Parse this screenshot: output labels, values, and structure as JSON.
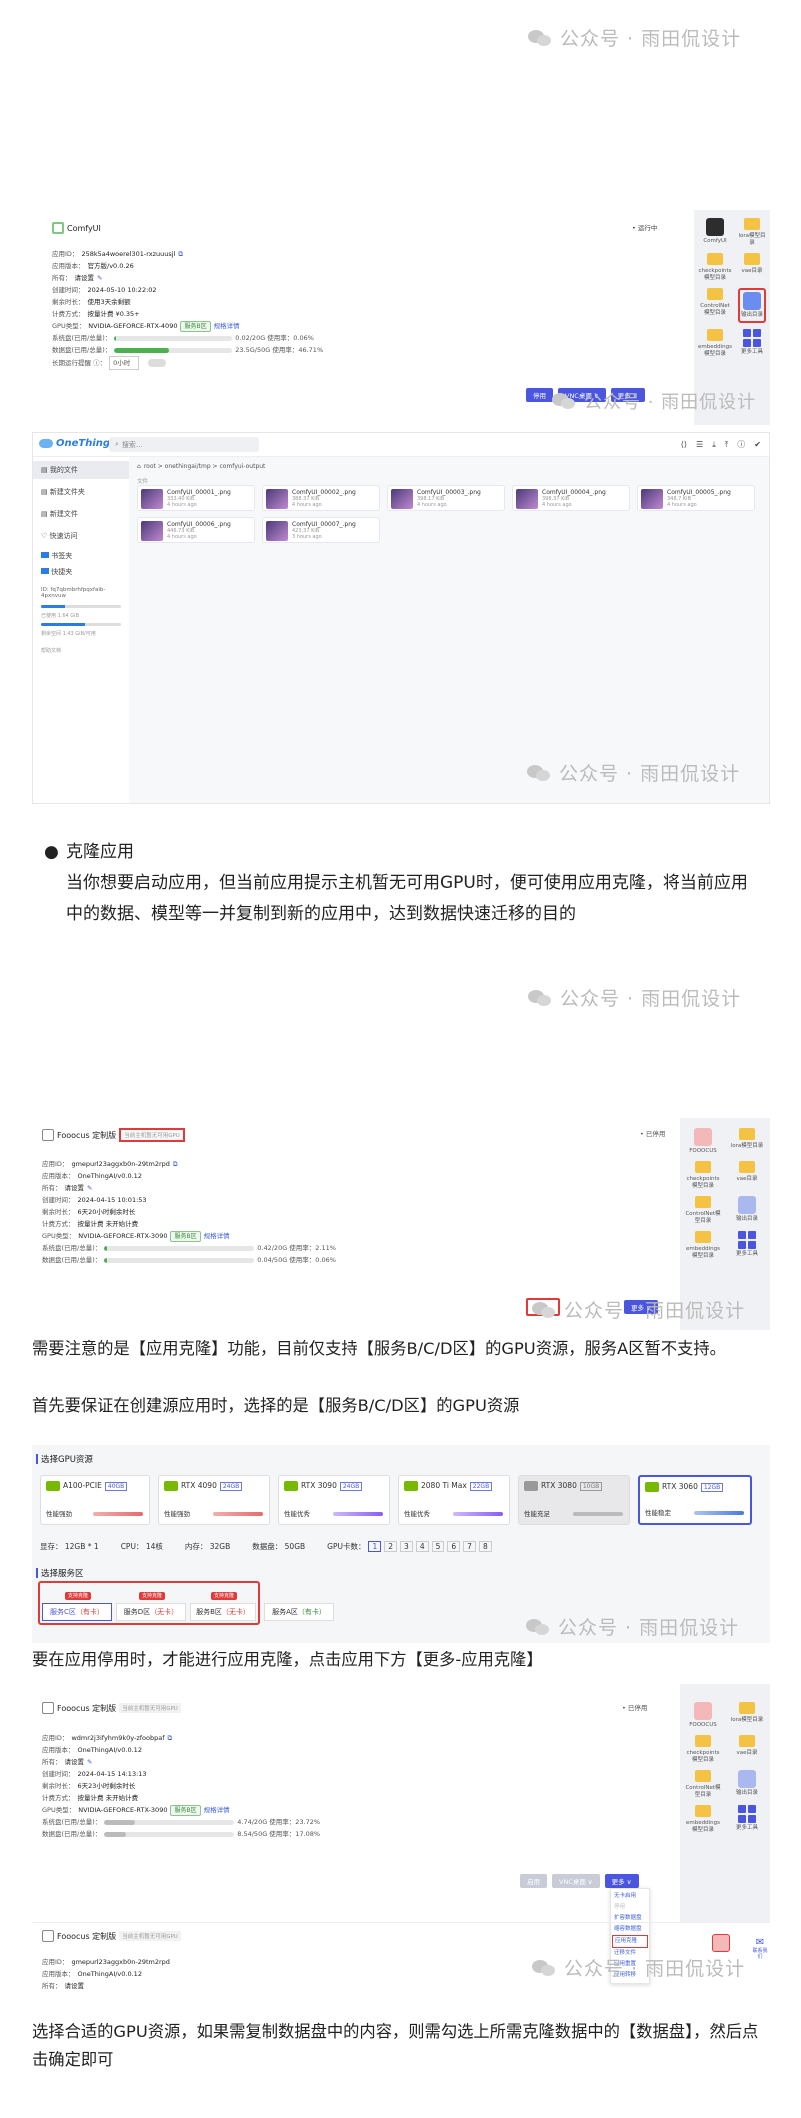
{
  "watermark": "公众号 · 雨田侃设计",
  "shot1": {
    "app_title": "ComfyUI",
    "status": "• 运行中",
    "fields": [
      {
        "label": "应用ID：",
        "value": "258k5a4woerel301-rxzuuusjl"
      },
      {
        "label": "应用版本：",
        "value": "官方版/v0.0.26"
      },
      {
        "label": "所有：",
        "value": "请设置"
      },
      {
        "label": "创建时间：",
        "value": "2024-05-10 10:22:02"
      },
      {
        "label": "剩余时长：",
        "value": "使用3天余剩额"
      },
      {
        "label": "计费方式：",
        "value": "按量计费   ¥0.35+"
      }
    ],
    "gpu_label": "GPU类型：",
    "gpu_value": "NVIDIA-GEFORCE-RTX-4090",
    "gpu_tag": "服务B区",
    "gpu_link": "规格详情",
    "sys_disk_label": "系统盘(已用/总量)：",
    "sys_disk_value": "0.02/20G   使用率：0.06%",
    "sys_disk_pct": 0.06,
    "data_disk_label": "数据盘(已用/总量)：",
    "data_disk_value": "23.5G/50G   使用率：46.71%",
    "data_disk_pct": 46.71,
    "stop_label": "长期运行提醒 ⓘ：",
    "stop_value": "0小时",
    "buttons": [
      "停用",
      "VNC桌面 ∨",
      "更多 ∨"
    ],
    "side_items": [
      "ComfyUI",
      "lora模型目录",
      "checkpoints模型目录",
      "vae目录",
      "ControlNet模型目录",
      "输出目录",
      "embeddings模型目录",
      "更多工具"
    ]
  },
  "shot2": {
    "brand": "OneThingAI",
    "search": "搜索...",
    "breadcrumb": "root  >  onethingai/tmp  >  comfyui-output",
    "nav": [
      "我的文件",
      "新建文件夹",
      "新建文件",
      "快速访问"
    ],
    "folders": [
      "书签夹",
      "快捷夹"
    ],
    "storage1": "已使用  1.64 GiB",
    "storage2": "剩余空间  1.43 GiB/可用",
    "path": "ID: fq7qbmbrhfpqxfaib-4pxnvuw",
    "help": "帮助文档",
    "section": "文件",
    "files": [
      {
        "name": "ComfyUI_00001_.png",
        "size": "333.40 KiB",
        "time": "4 hours ago"
      },
      {
        "name": "ComfyUI_00002_.png",
        "size": "388.37 KiB",
        "time": "4 hours ago"
      },
      {
        "name": "ComfyUI_00003_.png",
        "size": "398.17 KiB",
        "time": "4 hours ago"
      },
      {
        "name": "ComfyUI_00004_.png",
        "size": "398.37 KiB",
        "time": "4 hours ago"
      },
      {
        "name": "ComfyUI_00005_.png",
        "size": "348.7 KiB",
        "time": "4 hours ago"
      },
      {
        "name": "ComfyUI_00006_.png",
        "size": "446.73 KiB",
        "time": "4 hours ago"
      },
      {
        "name": "ComfyUI_00007_.png",
        "size": "423.37 KiB",
        "time": "3 hours ago"
      }
    ]
  },
  "section_clone": {
    "bullet_title": "克隆应用",
    "body": "当你想要启动应用，但当前应用提示主机暂无可用GPU时，便可使用应用克隆，将当前应用中的数据、模型等一并复制到新的应用中，达到数据快速迁移的目的"
  },
  "shot3": {
    "app_title": "Fooocus 定制版",
    "alert": "当前主机暂无可用GPU",
    "status": "• 已停用",
    "fields": [
      {
        "label": "应用ID：",
        "value": "gmepurl23aggxb0n-29tm2rpd"
      },
      {
        "label": "应用版本：",
        "value": "OneThingAI/v0.0.12"
      },
      {
        "label": "所有：",
        "value": "请设置"
      },
      {
        "label": "创建时间：",
        "value": "2024-04-15 10:01:53"
      },
      {
        "label": "剩余时长：",
        "value": "6天20小时剩余时长"
      },
      {
        "label": "计费方式：",
        "value": "按量计费   未开始计费"
      }
    ],
    "gpu_label": "GPU类型：",
    "gpu_value": "NVIDIA-GEFORCE-RTX-3090",
    "gpu_tag": "服务B区",
    "gpu_link": "规格详情",
    "sys_disk_label": "系统盘(已用/总量)：",
    "sys_disk_value": "0.42/20G   使用率：2.11%",
    "sys_disk_pct": 2.11,
    "data_disk_label": "数据盘(已用/总量)：",
    "data_disk_value": "0.04/50G   使用率：0.06%",
    "data_disk_pct": 0.06,
    "buttons": [
      "启用",
      "更多 ∨"
    ],
    "side_items": [
      "FOOOCUS",
      "lora模型目录",
      "checkpoints模型目录",
      "vae目录",
      "ControlNet模型目录",
      "输出目录",
      "embeddings模型目录",
      "更多工具"
    ]
  },
  "para1": "需要注意的是【应用克隆】功能，目前仅支持【服务B/C/D区】的GPU资源，服务A区暂不支持。",
  "para2": "首先要保证在创建源应用时，选择的是【服务B/C/D区】的GPU资源",
  "shot4": {
    "gpu_section": "选择GPU资源",
    "gpus": [
      {
        "name": "A100-PCIE",
        "mem": "40GB",
        "perf": "性能强劲",
        "bar": "#e86a6a"
      },
      {
        "name": "RTX 4090",
        "mem": "24GB",
        "perf": "性能强劲",
        "bar": "#e86a6a"
      },
      {
        "name": "RTX 3090",
        "mem": "24GB",
        "perf": "性能优秀",
        "bar": "#8b5cf6"
      },
      {
        "name": "2080 Ti Max",
        "mem": "22GB",
        "perf": "性能优秀",
        "bar": "#8b5cf6"
      },
      {
        "name": "RTX 3080",
        "mem": "10GB",
        "perf": "性能充足",
        "bar": "#bbbbbb"
      },
      {
        "name": "RTX 3060",
        "mem": "12GB",
        "perf": "性能稳定",
        "bar": "#4a7ae0"
      }
    ],
    "specs": [
      "显存： 12GB * 1",
      "CPU： 14核",
      "内存： 32GB",
      "数据盘： 50GB"
    ],
    "gpu_count_label": "GPU卡数：",
    "gpu_counts": [
      "1",
      "2",
      "3",
      "4",
      "5",
      "6",
      "7",
      "8"
    ],
    "zone_section": "选择服务区",
    "zones": [
      {
        "name": "服务C区",
        "avail": "（有卡）",
        "badge": "支持克隆"
      },
      {
        "name": "服务D区",
        "avail": "（无卡）",
        "badge": "支持克隆"
      },
      {
        "name": "服务B区",
        "avail": "（无卡）",
        "badge": "支持克隆"
      },
      {
        "name": "服务A区",
        "avail": "（有卡）",
        "badge": ""
      }
    ]
  },
  "para3": "要在应用停用时，才能进行应用克隆，点击应用下方【更多-应用克隆】",
  "shot5": {
    "app_title": "Fooocus 定制版",
    "alert": "当前主机暂无可用GPU",
    "status": "• 已停用",
    "fields": [
      {
        "label": "应用ID：",
        "value": "wdmr2j3ifyhm9k0y-zfoobpaf"
      },
      {
        "label": "应用版本：",
        "value": "OneThingAI/v0.0.12"
      },
      {
        "label": "所有：",
        "value": "请设置"
      },
      {
        "label": "创建时间：",
        "value": "2024-04-15 14:13:13"
      },
      {
        "label": "剩余时长：",
        "value": "6天23小时剩余时长"
      },
      {
        "label": "计费方式：",
        "value": "按量计费   未开始计费"
      }
    ],
    "gpu_label": "GPU类型：",
    "gpu_value": "NVIDIA-GEFORCE-RTX-3090",
    "gpu_tag": "服务B区",
    "gpu_link": "规格详情",
    "sys_disk_label": "系统盘(已用/总量)：",
    "sys_disk_value": "4.74/20G   使用率：23.72%",
    "sys_disk_pct": 23.72,
    "data_disk_label": "数据盘(已用/总量)：",
    "data_disk_value": "8.54/50G   使用率：17.08%",
    "data_disk_pct": 17.08,
    "buttons": [
      "启用",
      "VNC桌面 ∨",
      "更多 ∨"
    ],
    "menu": [
      "无卡启用",
      "停用",
      "扩容数据盘",
      "缩容数据盘",
      "应用克隆",
      "迁移文件",
      "应用重置",
      "应用转移"
    ],
    "side_items": [
      "FOOOCUS",
      "lora模型目录",
      "checkpoints模型目录",
      "vae目录",
      "ControlNet模型目录",
      "输出目录",
      "embeddings模型目录",
      "更多工具"
    ],
    "float_btn": "联系我们",
    "next_title": "Fooocus 定制版",
    "next_alert": "当前主机暂无可用GPU",
    "next_fields": [
      {
        "label": "应用ID：",
        "value": "gmepurl23aggxb0n-29tm2rpd"
      },
      {
        "label": "应用版本：",
        "value": "OneThingAI/v0.0.12"
      },
      {
        "label": "所有：",
        "value": "请设置"
      }
    ]
  },
  "para4": "选择合适的GPU资源，如果需复制数据盘中的内容，则需勾选上所需克隆数据中的【数据盘】，然后点击确定即可"
}
